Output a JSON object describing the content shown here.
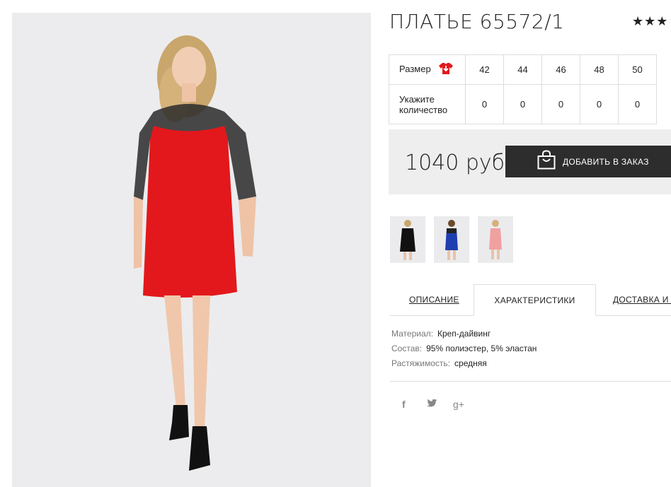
{
  "product": {
    "title": "ПЛАТЬЕ 65572/1",
    "rating_stars": "★★★"
  },
  "size_table": {
    "size_label": "Размер",
    "qty_label_line1": "Укажите",
    "qty_label_line2": "количество",
    "sizes": [
      "42",
      "44",
      "46",
      "48",
      "50"
    ],
    "quantities": [
      "0",
      "0",
      "0",
      "0",
      "0"
    ]
  },
  "purchase": {
    "price": "1040 руб",
    "add_button_label": "ДОБАВИТЬ В ЗАКАЗ"
  },
  "color_variants": [
    "black",
    "blue",
    "pink"
  ],
  "tabs": {
    "description": "ОПИСАНИЕ",
    "characteristics": "ХАРАКТЕРИСТИКИ",
    "delivery": "ДОСТАВКА И О"
  },
  "specs": [
    {
      "key": "Материал:",
      "value": "Креп-дайвинг"
    },
    {
      "key": "Состав:",
      "value": "95% полиэстер, 5% эластан"
    },
    {
      "key": "Растяжимость:",
      "value": "средняя"
    }
  ],
  "social": {
    "facebook": "f",
    "twitter": "twitter-icon",
    "gplus": "g+"
  },
  "colors": {
    "dress_red": "#e3181c",
    "button_dark": "#2d2d2d",
    "price_bg": "#eeeeee"
  }
}
